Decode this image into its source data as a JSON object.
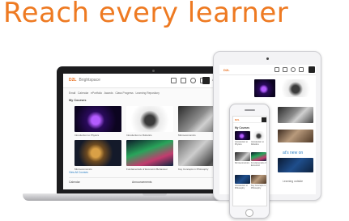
{
  "headline": "Reach every learner",
  "app": {
    "brand": "D2L",
    "product": "Brightspace",
    "user": "Adam Smith"
  },
  "laptop": {
    "nav_items": [
      "Email",
      "Calendar",
      "ePortfolio",
      "Awards",
      "Class Progress",
      "Learning Repository"
    ],
    "section_title": "My Courses",
    "courses": [
      {
        "name": "Introduction to Physics",
        "image": "physics"
      },
      {
        "name": "Introduction to Robotics",
        "image": "robotics"
      },
      {
        "name": "Microeconomics",
        "image": "micro"
      },
      {
        "name": "Microeconomics",
        "image": "world"
      },
      {
        "name": "Fundamentals of Economic Behaviour",
        "image": "fund"
      },
      {
        "name": "Key Concepts in Philosophy",
        "image": "key"
      }
    ],
    "view_all": "View All Courses",
    "widgets": [
      "Calendar",
      "Announcements"
    ]
  },
  "tablet": {
    "brand": "D2L",
    "side_label": "",
    "link_text": "at's new on",
    "small_text": "Learning outside"
  },
  "phone": {
    "brand": "D2L",
    "section_title": "My Courses",
    "courses": [
      {
        "name": "Introduction to Physics",
        "image": "physics"
      },
      {
        "name": "Introduction to Robotics",
        "image": "robotics"
      },
      {
        "name": "Microeconomics",
        "image": "micro"
      },
      {
        "name": "Fundamentals of Economic",
        "image": "fund"
      },
      {
        "name": "Introduction to Philosophy",
        "image": "dark"
      },
      {
        "name": "Key Concepts in Philosophy",
        "image": "book"
      }
    ]
  },
  "colors": {
    "accent": "#ee7a22",
    "link": "#2a7fc4"
  }
}
